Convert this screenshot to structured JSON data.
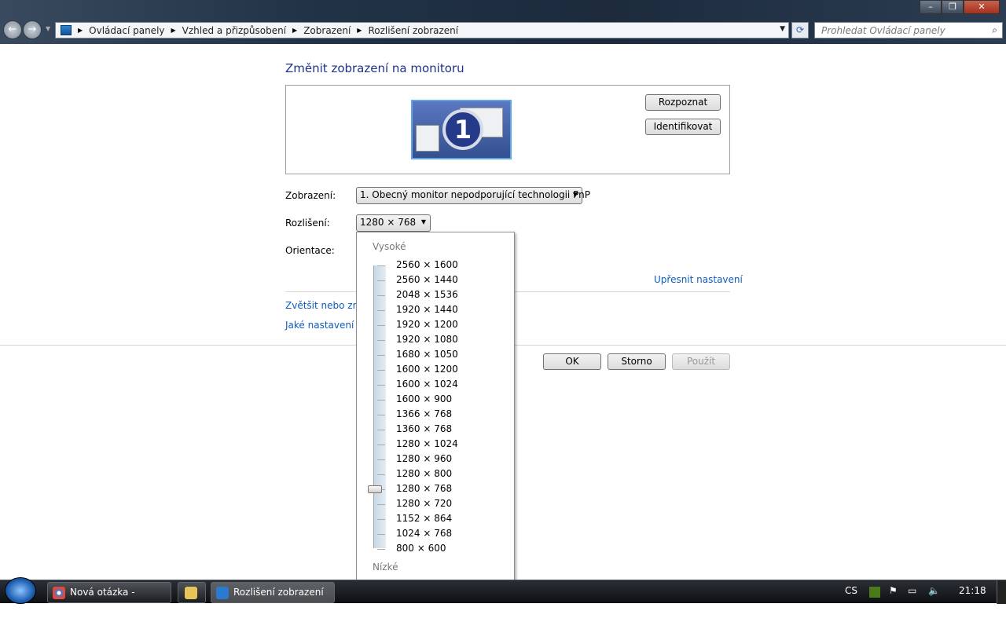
{
  "window": {
    "minimize": "–",
    "maximize": "❐",
    "close": "✕"
  },
  "address": {
    "crumbs": [
      "Ovládací panely",
      "Vzhled a přizpůsobení",
      "Zobrazení",
      "Rozlišení zobrazení"
    ],
    "search_placeholder": "Prohledat Ovládací panely"
  },
  "main": {
    "title": "Změnit zobrazení na monitoru",
    "monitor_number": "1",
    "detect": "Rozpoznat",
    "identify": "Identifikovat",
    "display_label": "Zobrazení:",
    "display_value": "1. Obecný monitor nepodporující technologii PnP",
    "resolution_label": "Rozlišení:",
    "resolution_value": "1280 × 768",
    "orientation_label": "Orientace:",
    "advanced_link": "Upřesnit nastavení",
    "link1": "Zvětšit nebo zme",
    "link2": "Jaké nastavení m",
    "ok": "OK",
    "cancel": "Storno",
    "apply": "Použít"
  },
  "dropdown": {
    "high": "Vysoké",
    "low": "Nízké",
    "selected_index": 15,
    "items": [
      "2560 × 1600",
      "2560 × 1440",
      "2048 × 1536",
      "1920 × 1440",
      "1920 × 1200",
      "1920 × 1080",
      "1680 × 1050",
      "1600 × 1200",
      "1600 × 1024",
      "1600 × 900",
      "1366 × 768",
      "1360 × 768",
      "1280 × 1024",
      "1280 × 960",
      "1280 × 800",
      "1280 × 768",
      "1280 × 720",
      "1152 × 864",
      "1024 × 768",
      "800 × 600"
    ]
  },
  "taskbar": {
    "items": [
      "Nová otázka - porad...",
      "Rozlišení zobrazení"
    ],
    "lang": "CS",
    "clock": "21:18"
  }
}
